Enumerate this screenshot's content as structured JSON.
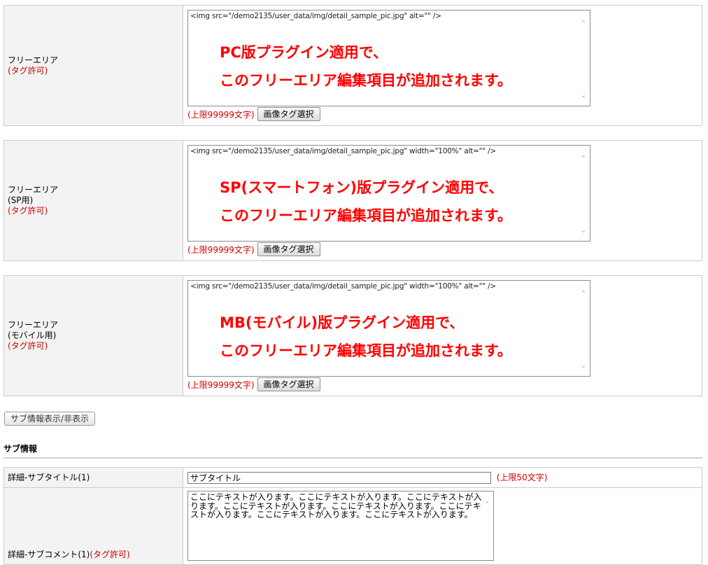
{
  "free_area_pc": {
    "label": "フリーエリア",
    "tag_note": "(タグ許可)",
    "code": "<img src=\"/demo2135/user_data/img/detail_sample_pic.jpg\" alt=\"\" />",
    "overlay_line1": "PC版プラグイン適用で、",
    "overlay_line2": "このフリーエリア編集項目が追加されます。",
    "limit": "(上限99999文字)",
    "button": "画像タグ選択"
  },
  "free_area_sp": {
    "label": "フリーエリア",
    "sub": "(SP用)",
    "tag_note": "(タグ許可)",
    "code": "<img src=\"/demo2135/user_data/img/detail_sample_pic.jpg\" width=\"100%\" alt=\"\" />",
    "overlay_line1": "SP(スマートフォン)版プラグイン適用で、",
    "overlay_line2": "このフリーエリア編集項目が追加されます。",
    "limit": "(上限99999文字)",
    "button": "画像タグ選択"
  },
  "free_area_mb": {
    "label": "フリーエリア",
    "sub": "(モバイル用)",
    "tag_note": "(タグ許可)",
    "code": "<img src=\"/demo2135/user_data/img/detail_sample_pic.jpg\" width=\"100%\" alt=\"\" />",
    "overlay_line1": "MB(モバイル)版プラグイン適用で、",
    "overlay_line2": "このフリーエリア編集項目が追加されます。",
    "limit": "(上限99999文字)",
    "button": "画像タグ選択"
  },
  "toggle_button": "サブ情報表示/非表示",
  "sub_section": {
    "title": "サブ情報",
    "subtitle_label": "詳細-サブタイトル(1)",
    "subtitle_value": "サブタイトル",
    "subtitle_limit": "(上限50文字)",
    "comment_label": "詳細-サブコメント(1)",
    "comment_tag_note": "(タグ許可)",
    "comment_value": "ここにテキストが入ります。ここにテキストが入ります。ここにテキストが入ります。ここにテキストが入ります。ここにテキストが入ります。ここにテキストが入ります。ここにテキストが入ります。ここにテキストが入ります。"
  }
}
